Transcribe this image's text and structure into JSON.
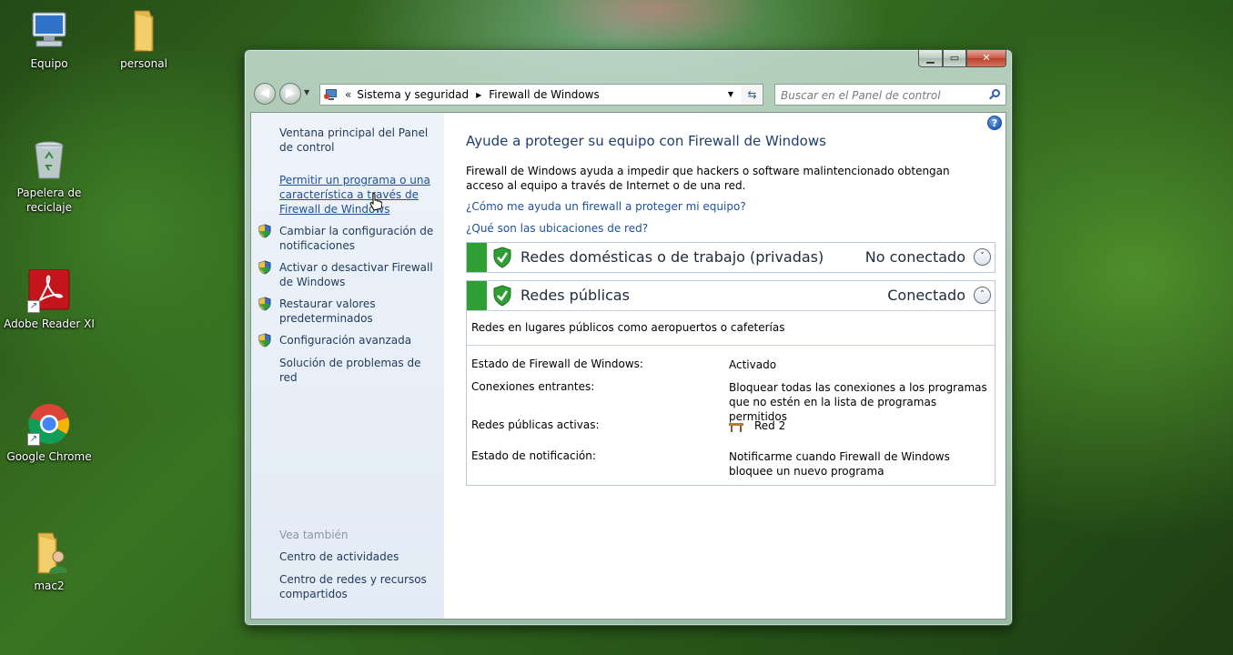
{
  "desktop": {
    "icons": [
      {
        "label": "Equipo",
        "icon": "computer-icon"
      },
      {
        "label": "personal",
        "icon": "folder-icon"
      },
      {
        "label": "Papelera de reciclaje",
        "icon": "recycle-bin-icon"
      },
      {
        "label": "Adobe Reader XI",
        "icon": "adobe-reader-icon"
      },
      {
        "label": "Google Chrome",
        "icon": "chrome-icon"
      },
      {
        "label": "mac2",
        "icon": "user-folder-icon"
      }
    ]
  },
  "window": {
    "caption": {
      "minimize": "▁",
      "maximize": "▭",
      "close": "✕"
    },
    "address": {
      "prefix": "«",
      "crumbs": [
        "Sistema y seguridad",
        "Firewall de Windows"
      ]
    },
    "search": {
      "placeholder": "Buscar en el Panel de control"
    },
    "sidebar": {
      "home": "Ventana principal del Panel de control",
      "items": [
        {
          "label": "Permitir un programa o una característica a través de Firewall de Windows",
          "shield": false
        },
        {
          "label": "Cambiar la configuración de notificaciones",
          "shield": true
        },
        {
          "label": "Activar o desactivar Firewall de Windows",
          "shield": true
        },
        {
          "label": "Restaurar valores predeterminados",
          "shield": true
        },
        {
          "label": "Configuración avanzada",
          "shield": true
        },
        {
          "label": "Solución de problemas de red",
          "shield": false
        }
      ],
      "see_also_heading": "Vea también",
      "see_also": [
        "Centro de actividades",
        "Centro de redes y recursos compartidos"
      ]
    },
    "main": {
      "title": "Ayude a proteger su equipo con Firewall de Windows",
      "description": "Firewall de Windows ayuda a impedir que hackers o software malintencionado obtengan acceso al equipo a través de Internet o de una red.",
      "links": [
        "¿Cómo me ayuda un firewall a proteger mi equipo?",
        "¿Qué son las ubicaciones de red?"
      ],
      "private_network": {
        "name": "Redes domésticas o de trabajo (privadas)",
        "status": "No conectado",
        "toggle": "˅"
      },
      "public_network": {
        "name": "Redes públicas",
        "status": "Conectado",
        "toggle": "˄",
        "subtitle": "Redes en lugares públicos como aeropuertos o cafeterías",
        "details": [
          {
            "label": "Estado de Firewall de Windows:",
            "value": "Activado"
          },
          {
            "label": "Conexiones entrantes:",
            "value": "Bloquear todas las conexiones a los programas que no estén en la lista de programas permitidos"
          },
          {
            "label": "Redes públicas activas:",
            "value": "Red  2"
          },
          {
            "label": "Estado de notificación:",
            "value": "Notificarme cuando Firewall de Windows bloquee un nuevo programa"
          }
        ]
      }
    },
    "colors": {
      "status_green": "#2f9e33",
      "link": "#1f4f9a",
      "title": "#1e3f6b"
    }
  }
}
